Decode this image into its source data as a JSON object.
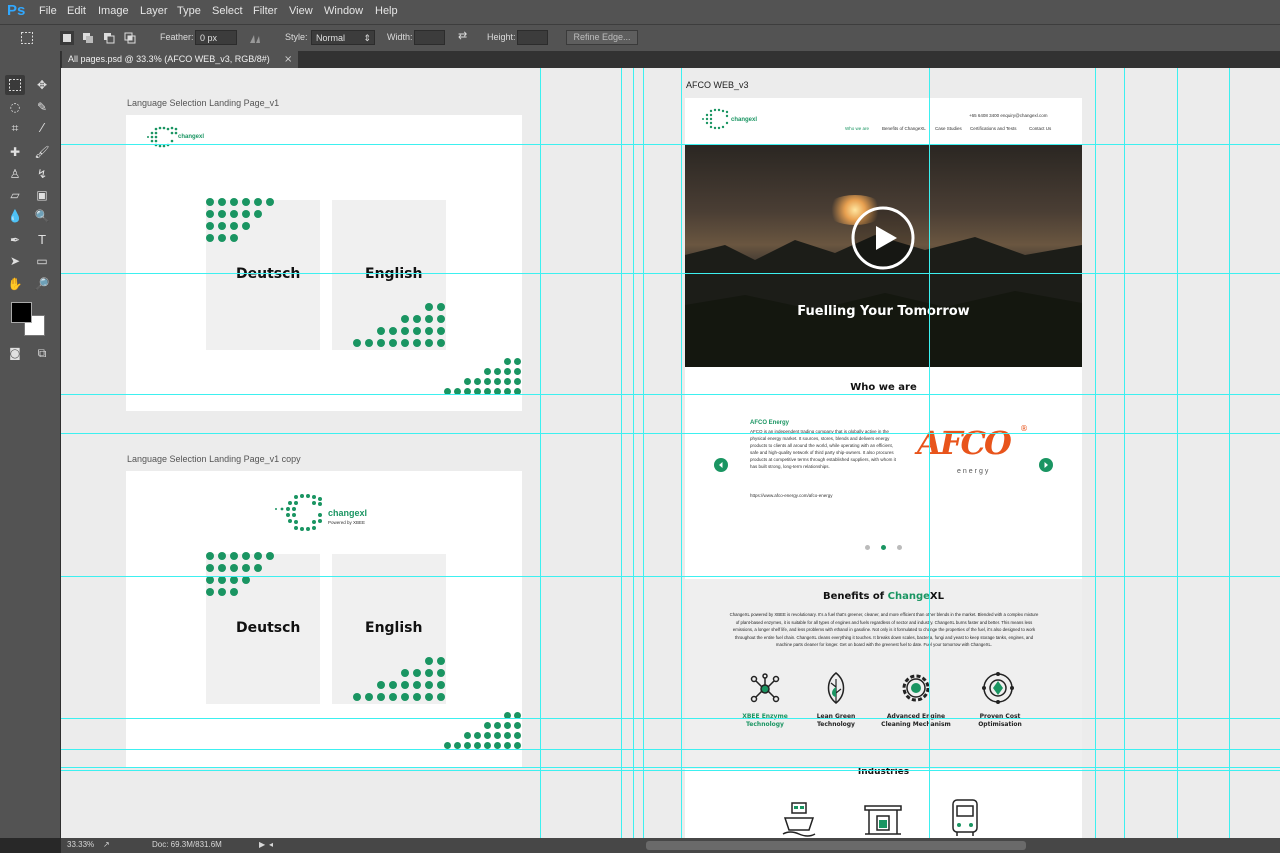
{
  "app": {
    "logo": "Ps"
  },
  "menu": [
    "File",
    "Edit",
    "Image",
    "Layer",
    "Type",
    "Select",
    "Filter",
    "View",
    "Window",
    "Help"
  ],
  "options": {
    "feather_label": "Feather:",
    "feather_value": "0 px",
    "style_label": "Style:",
    "style_value": "Normal",
    "width_label": "Width:",
    "height_label": "Height:",
    "refine_edge": "Refine Edge..."
  },
  "document_tab": {
    "title": "All pages.psd @ 33.3% (AFCO WEB_v3, RGB/8#)",
    "close": "×"
  },
  "artboards": {
    "landing_v1": {
      "label": "Language Selection Landing Page_v1",
      "lang_de": "Deutsch",
      "lang_en": "English"
    },
    "landing_v1_copy": {
      "label": "Language Selection Landing Page_v1 copy",
      "lang_de": "Deutsch",
      "lang_en": "English",
      "logo_text": "changexl",
      "logo_sub": "Powered by XBEE"
    },
    "afco_web": {
      "label": "AFCO WEB_v3",
      "header_contact": "+65 6408 3400  enquiry@changexl.com",
      "logo_text": "changexl",
      "nav": [
        "Who we are",
        "Benefits of ChangeXL",
        "Case Studies",
        "Certifications and Tests",
        "Contact Us"
      ],
      "hero_title": "Fuelling Your Tomorrow",
      "who_title": "Who we are",
      "slide_title": "AFCO Energy",
      "slide_body": "AFCO is an independent trading company that is globally active in the physical energy market. It sources, stores, blends and delivers energy products to clients all around the world, while operating with an efficient, safe and high-quality network of third party ship-owners. It also procures products at competitive terms through established suppliers, with whom it has built strong, long-term relationships.",
      "slide_link": "https://www.afco-energy.com/afco-energy",
      "afco_logo": "AFCO",
      "afco_sub": "energy",
      "benefits_title_a": "Benefits of ",
      "benefits_title_b": "Change",
      "benefits_title_c": "XL",
      "benefits_body": "ChangeXL powered by XBEE is revolutionary. It's a fuel that's greener, cleaner, and more efficient than other blends in the market. Blended with a complex mixture of plant-based enzymes, it is suitable for all types of engines and fuels regardless of sector and industry. ChangeXL burns faster and better. This means less emissions, a longer shelf life, and less problems with ethanol in gasoline. Not only is it formulated to change the properties of the fuel, it's also designed to work throughout the entire fuel chain. ChangeXL cleans everything it touches. It breaks down scales, bacteria, fungi and yeast to keep storage tanks, engines, and machine parts cleaner for longer. Get on board with the greenest fuel to date. Fuel your tomorrow with ChangeXL.",
      "features": [
        {
          "l1": "XBEE Enzyme",
          "l2": "Technology"
        },
        {
          "l1": "Lean Green",
          "l2": "Technology"
        },
        {
          "l1": "Advanced Engine",
          "l2": "Cleaning Mechanism"
        },
        {
          "l1": "Proven Cost",
          "l2": "Optimisation"
        }
      ],
      "industries_title": "Industries"
    }
  },
  "status": {
    "zoom": "33.33%",
    "doc": "Doc: 69.3M/831.6M"
  },
  "colors": {
    "brand_green": "#1a9562",
    "guide": "#3df0f0",
    "afco_orange": "#e8541b"
  }
}
